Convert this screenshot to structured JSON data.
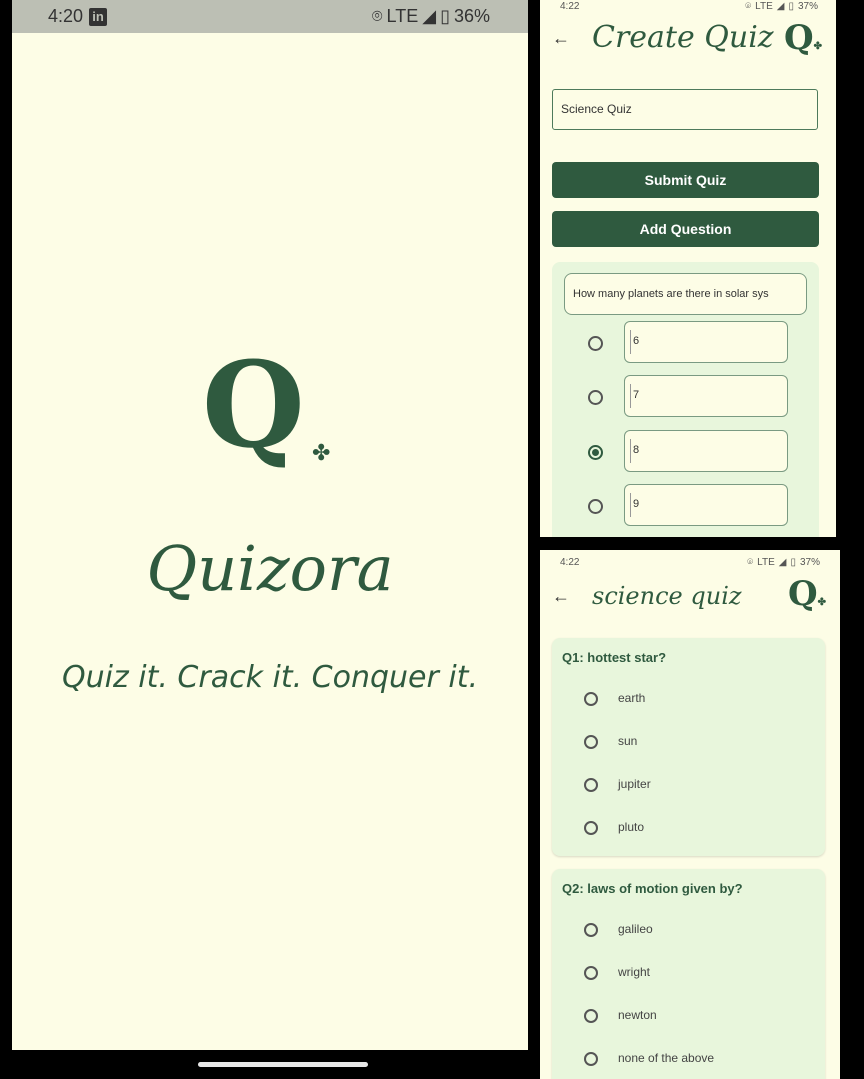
{
  "splash": {
    "status": {
      "time": "4:20",
      "app_icon": "in",
      "network": "LTE",
      "battery": "36%"
    },
    "logo_letter": "Q",
    "app_name": "Quizora",
    "tagline": "Quiz it. Crack it. Conquer it."
  },
  "create": {
    "status": {
      "time": "4:22",
      "network": "LTE",
      "battery": "37%"
    },
    "title": "Create Quiz",
    "logo_letter": "Q",
    "quiz_title_value": "Science Quiz",
    "submit_label": "Submit Quiz",
    "add_label": "Add Question",
    "question_value": "How many planets are there in solar sys",
    "options": [
      {
        "value": "6",
        "selected": false
      },
      {
        "value": "7",
        "selected": false
      },
      {
        "value": "8",
        "selected": true
      },
      {
        "value": "9",
        "selected": false
      }
    ]
  },
  "preview": {
    "status": {
      "time": "4:22",
      "network": "LTE",
      "battery": "37%"
    },
    "title": "science quiz",
    "logo_letter": "Q",
    "questions": [
      {
        "text": "Q1: hottest star?",
        "options": [
          "earth",
          "sun",
          "jupiter",
          "pluto"
        ]
      },
      {
        "text": "Q2: laws of motion given by?",
        "options": [
          "galileo",
          "wright",
          "newton",
          "none of the above"
        ]
      }
    ]
  },
  "colors": {
    "primary": "#2f5a3f",
    "background": "#fdfde6",
    "card": "#e8f6dc"
  }
}
